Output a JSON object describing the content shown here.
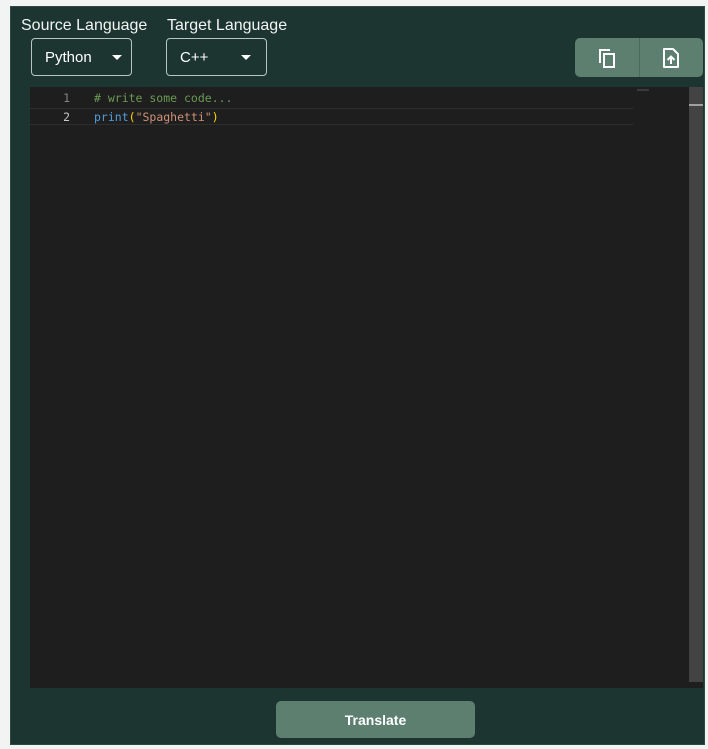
{
  "labels": {
    "source_language": "Source Language",
    "target_language": "Target Language"
  },
  "source_select": {
    "value": "Python"
  },
  "target_select": {
    "value": "C++"
  },
  "toolbar": {
    "icons": [
      "copy-icon",
      "file-upload-icon"
    ]
  },
  "editor": {
    "lines": [
      {
        "number": "1",
        "comment": "# write some code..."
      },
      {
        "number": "2",
        "fn": "print",
        "open": "(",
        "string": "\"Spaghetti\"",
        "close": ")"
      }
    ],
    "colors": {
      "background": "#1e1e1e",
      "comment": "#6a9955",
      "function": "#569cd6",
      "paren": "#ffd700",
      "string": "#ce9178"
    }
  },
  "actions": {
    "translate_label": "Translate"
  },
  "colors": {
    "panel_bg": "#1d3530",
    "accent": "#5c7f6f"
  }
}
